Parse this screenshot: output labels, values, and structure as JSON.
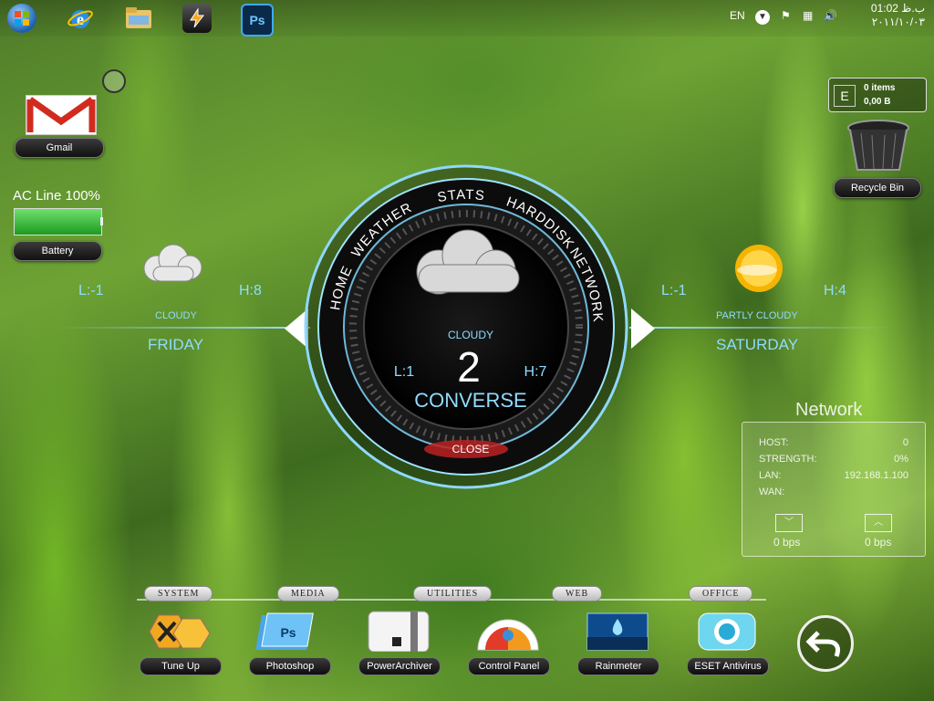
{
  "taskbar": {
    "icons": [
      {
        "name": "windows-start-icon"
      },
      {
        "name": "internet-explorer-icon"
      },
      {
        "name": "file-explorer-icon"
      },
      {
        "name": "winamp-icon"
      },
      {
        "name": "photoshop-icon",
        "text": "Ps"
      }
    ],
    "lang": "EN",
    "clock_time": "ب.ظ 01:02",
    "clock_date": "۲۰۱۱/۱۰/۰۳"
  },
  "gmail": {
    "label": "Gmail"
  },
  "battery": {
    "status": "AC Line 100%",
    "label": "Battery",
    "level": 1.0
  },
  "recycle": {
    "items": "0 items",
    "size": "0,00 B",
    "letter": "E",
    "label": "Recycle Bin"
  },
  "weather_left": {
    "low": "L:-1",
    "high": "H:8",
    "condition": "CLOUDY",
    "day": "FRIDAY"
  },
  "weather_right": {
    "low": "L:-1",
    "high": "H:4",
    "condition": "PARTLY CLOUDY",
    "day": "SATURDAY"
  },
  "hud": {
    "tabs": [
      "HOME",
      "WEATHER",
      "STATS",
      "HARDDISK",
      "NETWORK"
    ],
    "condition": "CLOUDY",
    "low": "L:1",
    "temp": "2",
    "high": "H:7",
    "location": "CONVERSE",
    "close": "CLOSE"
  },
  "network": {
    "title": "Network",
    "host_label": "HOST:",
    "host_value": "0",
    "strength_label": "STRENGTH:",
    "strength_value": "0%",
    "lan_label": "LAN:",
    "lan_value": "192.168.1.100",
    "wan_label": "WAN:",
    "down": "0 bps",
    "up": "0 bps"
  },
  "dock": {
    "tabs": [
      "SYSTEM",
      "MEDIA",
      "UTILITIES",
      "WEB",
      "OFFICE"
    ],
    "apps": [
      "Tune Up",
      "Photoshop",
      "PowerArchiver",
      "Control Panel",
      "Rainmeter",
      "ESET Antivirus"
    ]
  },
  "colors": {
    "accent": "#7fd4ff",
    "battery": "#2fb52f"
  }
}
